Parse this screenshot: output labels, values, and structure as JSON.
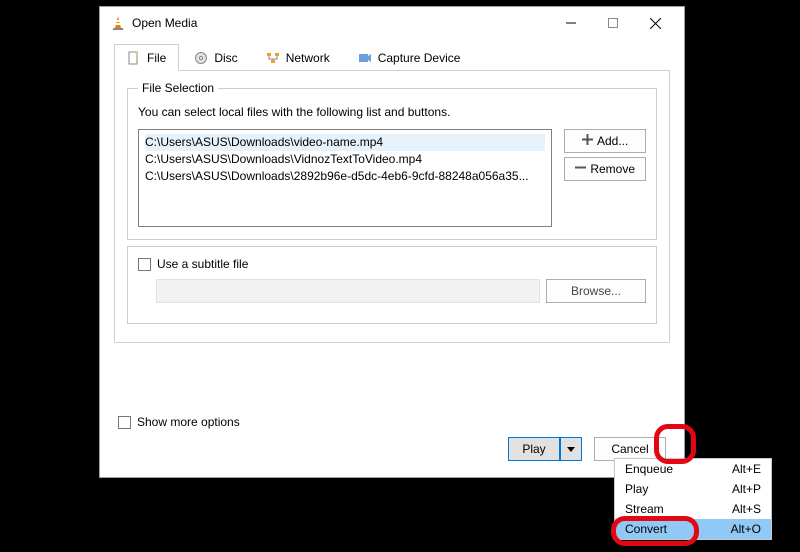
{
  "window": {
    "title": "Open Media"
  },
  "tabs": {
    "file": "File",
    "disc": "Disc",
    "network": "Network",
    "capture": "Capture Device"
  },
  "fileSelection": {
    "legend": "File Selection",
    "help": "You can select local files with the following list and buttons.",
    "files": [
      "C:\\Users\\ASUS\\Downloads\\video-name.mp4",
      "C:\\Users\\ASUS\\Downloads\\VidnozTextToVideo.mp4",
      "C:\\Users\\ASUS\\Downloads\\2892b96e-d5dc-4eb6-9cfd-88248a056a35..."
    ],
    "addLabel": "Add...",
    "removeLabel": "Remove"
  },
  "subtitle": {
    "label": "Use a subtitle file",
    "browse": "Browse..."
  },
  "moreOptions": "Show more options",
  "footer": {
    "play": "Play",
    "cancel": "Cancel"
  },
  "menu": {
    "items": [
      {
        "label": "Enqueue",
        "accel": "Alt+E"
      },
      {
        "label": "Play",
        "accel": "Alt+P"
      },
      {
        "label": "Stream",
        "accel": "Alt+S"
      },
      {
        "label": "Convert",
        "accel": "Alt+O"
      }
    ]
  }
}
